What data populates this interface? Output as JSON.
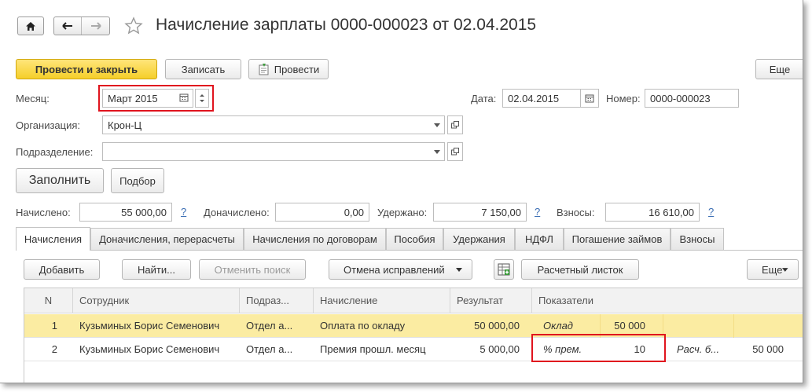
{
  "header": {
    "title": "Начисление зарплаты 0000-000023 от 02.04.2015"
  },
  "toolbar": {
    "post_close": "Провести и закрыть",
    "save": "Записать",
    "post": "Провести",
    "more": "Еще"
  },
  "form": {
    "month_label": "Месяц:",
    "month_value": "Март 2015",
    "date_label": "Дата:",
    "date_value": "02.04.2015",
    "number_label": "Номер:",
    "number_value": "0000-000023",
    "org_label": "Организация:",
    "org_value": "Крон-Ц",
    "dept_label": "Подразделение:",
    "dept_value": "",
    "fill_button": "Заполнить",
    "pick_button": "Подбор"
  },
  "totals": {
    "accrued_label": "Начислено:",
    "accrued_value": "55 000,00",
    "extra_label": "Доначислено:",
    "extra_value": "0,00",
    "withheld_label": "Удержано:",
    "withheld_value": "7 150,00",
    "contrib_label": "Взносы:",
    "contrib_value": "16 610,00",
    "help": "?"
  },
  "tabs": [
    "Начисления",
    "Доначисления, перерасчеты",
    "Начисления по договорам",
    "Пособия",
    "Удержания",
    "НДФЛ",
    "Погашение займов",
    "Взносы"
  ],
  "grid_toolbar": {
    "add": "Добавить",
    "find": "Найти...",
    "cancel_search": "Отменить поиск",
    "cancel_corrections": "Отмена исправлений",
    "payslip": "Расчетный листок",
    "more": "Еще"
  },
  "grid": {
    "columns": [
      "N",
      "Сотрудник",
      "Подраз...",
      "Начисление",
      "Результат",
      "Показатели"
    ],
    "rows": [
      {
        "n": "1",
        "employee": "Кузьминых Борис Семенович",
        "dept": "Отдел а...",
        "accrual": "Оплата по окладу",
        "result": "50 000,00",
        "ind1_name": "Оклад",
        "ind1_value": "50 000",
        "ind2_name": "",
        "ind2_value": ""
      },
      {
        "n": "2",
        "employee": "Кузьминых Борис Семенович",
        "dept": "Отдел а...",
        "accrual": "Премия прошл. месяц",
        "result": "5 000,00",
        "ind1_name": "% прем.",
        "ind1_value": "10",
        "ind2_name": "Расч. б...",
        "ind2_value": "50 000"
      }
    ]
  },
  "colors": {
    "primary_button": "#f5cf2a",
    "selected_row": "#fbeca2",
    "highlight_box": "#e0141e",
    "help_link": "#3c6fb4"
  },
  "icons": [
    "home-icon",
    "back-arrow-icon",
    "forward-arrow-icon",
    "star-icon",
    "post-icon",
    "calendar-icon",
    "spin-icon",
    "dropdown-icon",
    "open-icon",
    "table-settings-icon"
  ]
}
